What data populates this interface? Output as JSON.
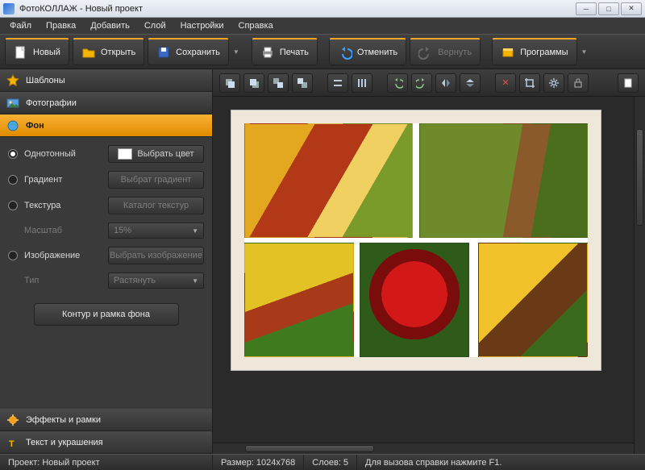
{
  "window": {
    "title": "ФотоКОЛЛАЖ - Новый проект"
  },
  "menu": {
    "file": "Файл",
    "edit": "Правка",
    "add": "Добавить",
    "layer": "Слой",
    "settings": "Настройки",
    "help": "Справка"
  },
  "toolbar": {
    "new": "Новый",
    "open": "Открыть",
    "save": "Сохранить",
    "print": "Печать",
    "undo": "Отменить",
    "redo": "Вернуть",
    "programs": "Программы"
  },
  "sidebar": {
    "tabs": {
      "templates": "Шаблоны",
      "photos": "Фотографии",
      "background": "Фон",
      "effects": "Эффекты и рамки",
      "text": "Текст и украшения"
    },
    "bg": {
      "solid_label": "Однотонный",
      "pick_color": "Выбрать цвет",
      "gradient_label": "Градиент",
      "pick_gradient": "Выбрат градиент",
      "texture_label": "Текстура",
      "texture_catalog": "Каталог текстур",
      "scale_label": "Масштаб",
      "scale_value": "15%",
      "image_label": "Изображение",
      "pick_image": "Выбрать изображение",
      "type_label": "Тип",
      "type_value": "Растянуть",
      "outline_btn": "Контур и рамка фона",
      "selected": "solid"
    }
  },
  "status": {
    "project": "Проект: Новый проект",
    "size": "Размер: 1024x768",
    "layers": "Слоев: 5",
    "help": "Для вызова справки нажмите F1."
  }
}
